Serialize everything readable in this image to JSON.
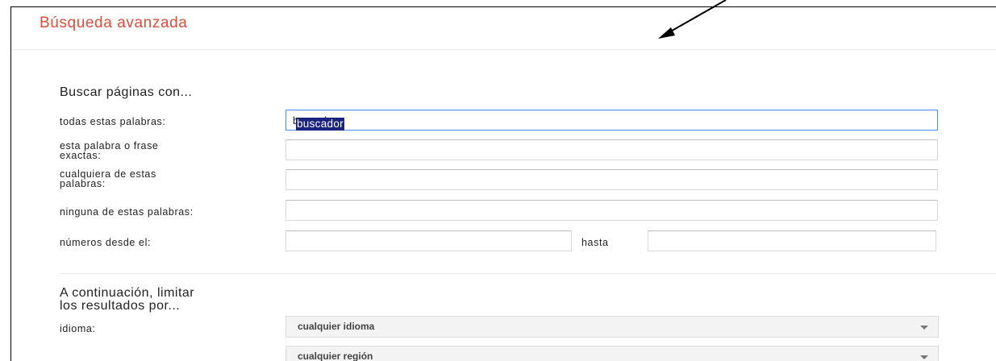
{
  "header": {
    "title": "Búsqueda avanzada"
  },
  "find_pages": {
    "heading": "Buscar páginas con...",
    "all_words_label": "todas estas palabras:",
    "all_words_value": "buscador",
    "exact_phrase_label_line1": "esta palabra o frase",
    "exact_phrase_label_line2": "exactas:",
    "exact_phrase_value": "",
    "any_words_label_line1": "cualquiera de estas",
    "any_words_label_line2": "palabras:",
    "any_words_value": "",
    "none_words_label": "ninguna de estas palabras:",
    "none_words_value": "",
    "numbers_from_label": "números desde el:",
    "numbers_from_value": "",
    "numbers_to_label": "hasta",
    "numbers_to_value": ""
  },
  "narrow_results": {
    "heading_line1": "A continuación, limitar",
    "heading_line2": "los resultados por...",
    "language_label": "idioma:",
    "language_selected": "cualquier idioma",
    "region_selected": "cualquier región"
  },
  "colors": {
    "title_red": "#dd4b39",
    "focus_blue": "#4d90fe",
    "selection_navy": "#1a237e"
  }
}
